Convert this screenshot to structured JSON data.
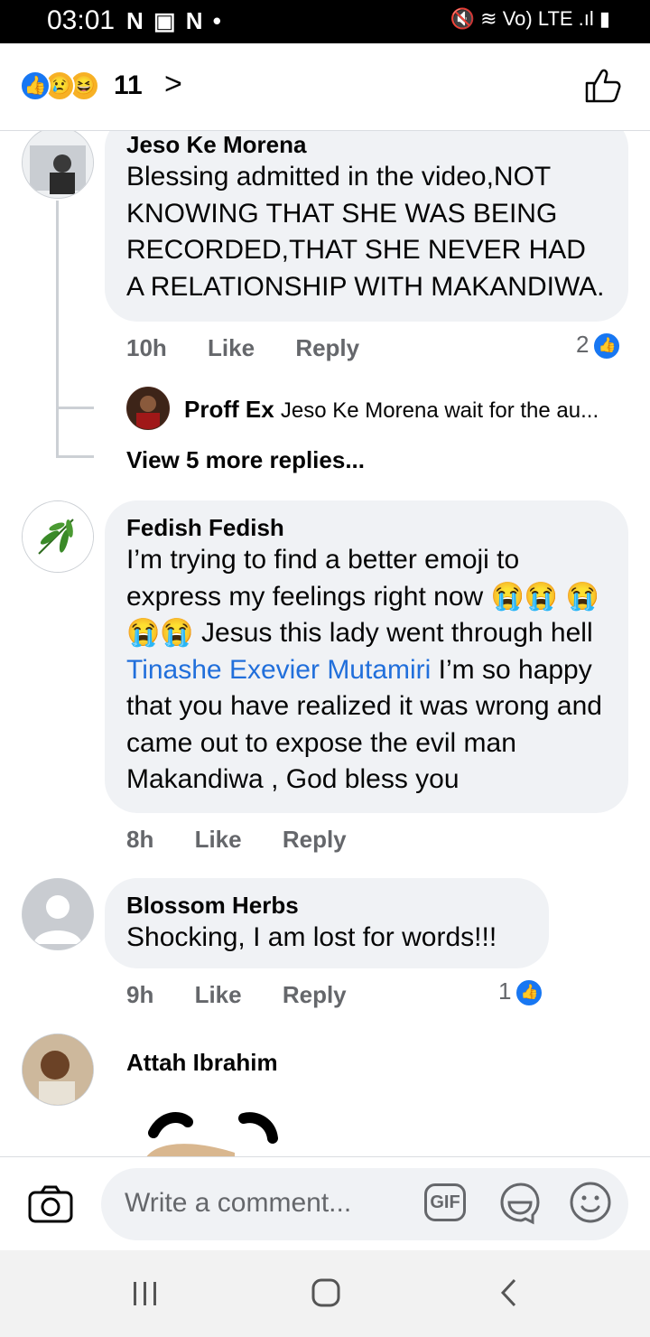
{
  "status_bar": {
    "time": "03:01",
    "left_icons": "N ▣ N •",
    "right_icons": "🔇 ≋ Vo) LTE .ıl ▮"
  },
  "header": {
    "reaction_count": "11",
    "reactions": [
      "like",
      "sad",
      "haha"
    ]
  },
  "comments": [
    {
      "author": "Jeso Ke Morena",
      "text": "Blessing admitted in the video,NOT KNOWING THAT SHE WAS BEING RECORDED,THAT SHE NEVER HAD A RELATIONSHIP WITH MAKANDIWA.",
      "time": "10h",
      "like_label": "Like",
      "reply_label": "Reply",
      "reactions": "2",
      "replies": {
        "preview_author": "Proff Ex",
        "preview_text": "Jeso Ke Morena wait for the au...",
        "view_more": "View 5 more replies..."
      }
    },
    {
      "author": "Fedish Fedish",
      "text_part1": "I’m trying to find a better emoji to express my feelings right now 😭😭 😭😭😭 Jesus this lady went through hell ",
      "mention": "Tinashe Exevier Mutamiri",
      "text_part2": " I’m so happy that you have realized it was wrong and came out to expose the evil man Makandiwa , God bless you",
      "time": "8h",
      "like_label": "Like",
      "reply_label": "Reply"
    },
    {
      "author": "Blossom Herbs",
      "text": "Shocking, I am lost for words!!!",
      "time": "9h",
      "like_label": "Like",
      "reply_label": "Reply",
      "reactions": "1"
    },
    {
      "author": "Attah Ibrahim"
    }
  ],
  "composer": {
    "placeholder": "Write a comment...",
    "gif_label": "GIF"
  },
  "colors": {
    "accent": "#1877f2",
    "mention": "#216fdb",
    "bubble": "#f0f2f5",
    "meta": "#65676b"
  }
}
